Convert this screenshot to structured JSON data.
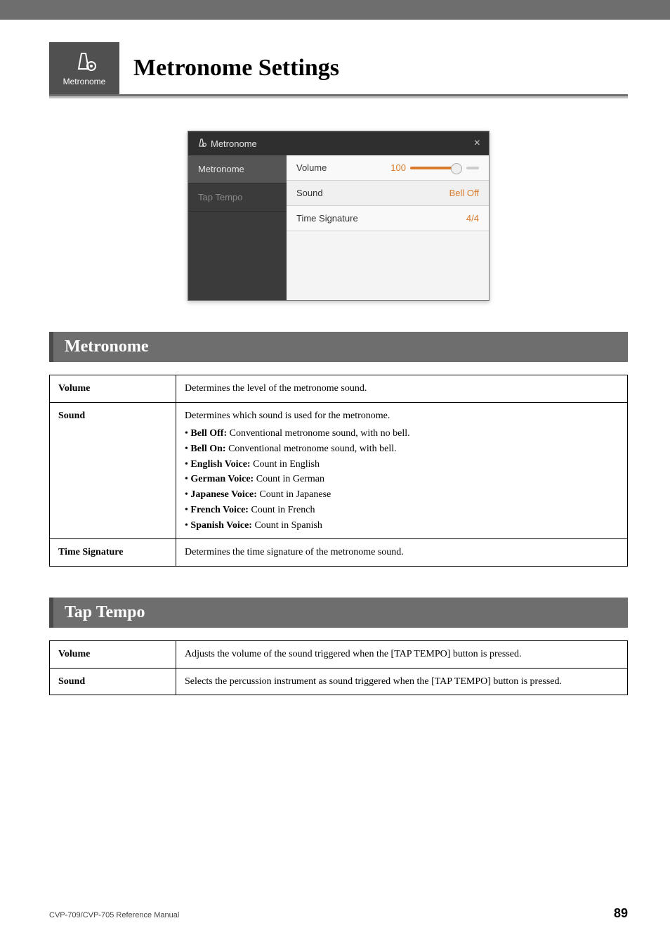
{
  "icon_box": {
    "label": "Metronome"
  },
  "page_title": "Metronome Settings",
  "screenshot": {
    "header_title": "Metronome",
    "close": "×",
    "side": {
      "item1": "Metronome",
      "item2": "Tap Tempo"
    },
    "rows": {
      "volume_label": "Volume",
      "volume_val": "100",
      "sound_label": "Sound",
      "sound_val": "Bell Off",
      "timesig_label": "Time Signature",
      "timesig_val": "4/4"
    }
  },
  "section1": {
    "heading": "Metronome",
    "rows": {
      "volume": {
        "label": "Volume",
        "desc": "Determines the level of the metronome sound."
      },
      "sound": {
        "label": "Sound",
        "desc": "Determines which sound is used for the metronome.",
        "items": [
          {
            "name": "Bell Off:",
            "rest": " Conventional metronome sound, with no bell."
          },
          {
            "name": "Bell On:",
            "rest": " Conventional metronome sound, with bell."
          },
          {
            "name": "English Voice:",
            "rest": " Count in English"
          },
          {
            "name": "German Voice:",
            "rest": " Count in German"
          },
          {
            "name": "Japanese Voice:",
            "rest": " Count in Japanese"
          },
          {
            "name": "French Voice:",
            "rest": " Count in French"
          },
          {
            "name": "Spanish Voice:",
            "rest": " Count in Spanish"
          }
        ]
      },
      "timesig": {
        "label": "Time Signature",
        "desc": "Determines the time signature of the metronome sound."
      }
    }
  },
  "section2": {
    "heading": "Tap Tempo",
    "rows": {
      "volume": {
        "label": "Volume",
        "desc": "Adjusts the volume of the sound triggered when the [TAP TEMPO] button is pressed."
      },
      "sound": {
        "label": "Sound",
        "desc": "Selects the percussion instrument as sound triggered when the [TAP TEMPO] button is pressed."
      }
    }
  },
  "footer": {
    "left": "CVP-709/CVP-705 Reference Manual",
    "right": "89"
  }
}
